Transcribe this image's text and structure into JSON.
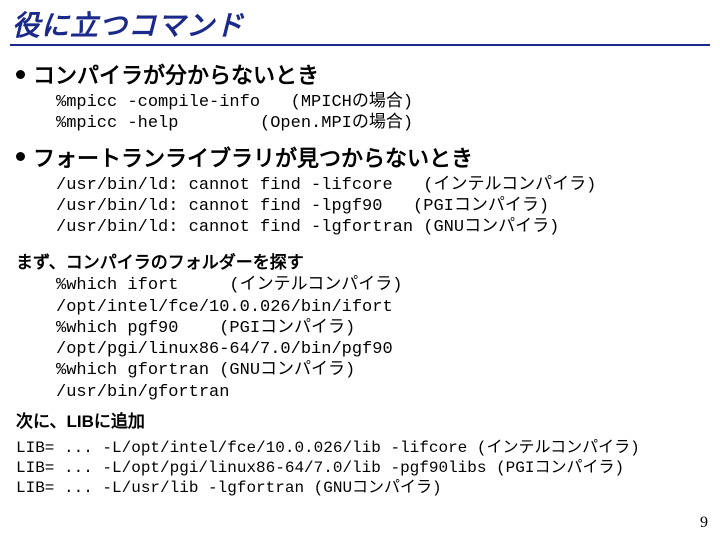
{
  "title": "役に立つコマンド",
  "bullet1": "コンパイラが分からないとき",
  "code1": "%mpicc -compile-info   (MPICHの場合)\n%mpicc -help        (Open.MPIの場合)",
  "bullet2": "フォートランライブラリが見つからないとき",
  "code2": "/usr/bin/ld: cannot find -lifcore   (インテルコンパイラ)\n/usr/bin/ld: cannot find -lpgf90   (PGIコンパイラ)\n/usr/bin/ld: cannot find -lgfortran (GNUコンパイラ)",
  "sub1": "まず、コンパイラのフォルダーを探す",
  "code3": "%which ifort     (インテルコンパイラ)\n/opt/intel/fce/10.0.026/bin/ifort\n%which pgf90    (PGIコンパイラ)\n/opt/pgi/linux86-64/7.0/bin/pgf90\n%which gfortran (GNUコンパイラ)\n/usr/bin/gfortran",
  "sub2": "次に、LIBに追加",
  "code4": "LIB= ... -L/opt/intel/fce/10.0.026/lib -lifcore (インテルコンパイラ)\nLIB= ... -L/opt/pgi/linux86-64/7.0/lib -pgf90libs (PGIコンパイラ)\nLIB= ... -L/usr/lib -lgfortran (GNUコンパイラ)",
  "page": "9"
}
